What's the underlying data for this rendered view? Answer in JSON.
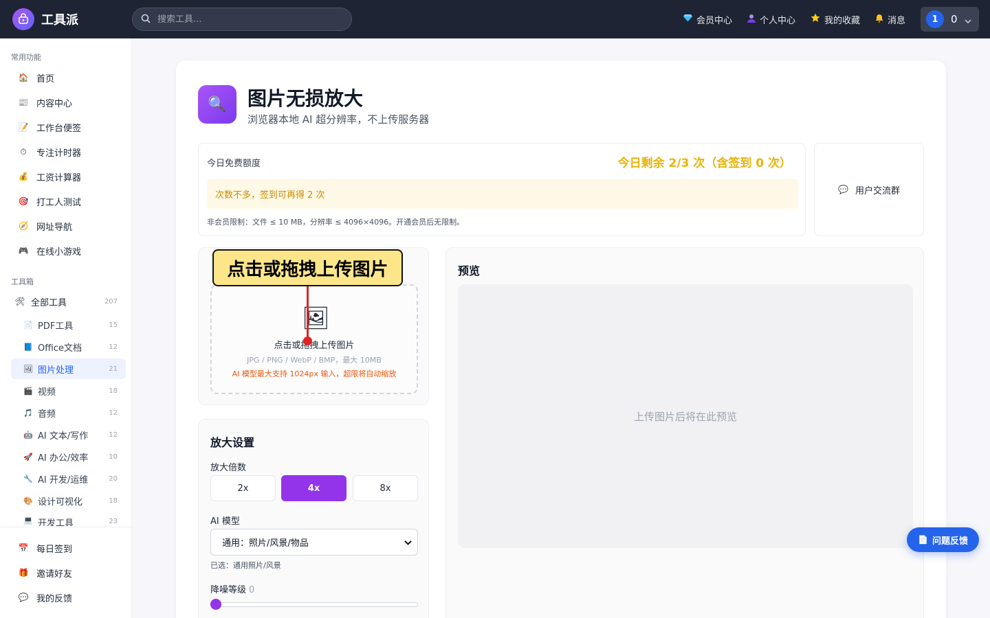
{
  "header": {
    "app_name": "工具派",
    "search_placeholder": "搜索工具...",
    "links": [
      {
        "icon": "gem-icon",
        "label": "会员中心"
      },
      {
        "icon": "person-icon",
        "label": "个人中心"
      },
      {
        "icon": "star-icon",
        "label": "我的收藏"
      },
      {
        "icon": "bell-icon",
        "label": "消息"
      }
    ],
    "user": {
      "avatar": "1",
      "count": "0"
    }
  },
  "sidebar": {
    "common_title": "常用功能",
    "common": [
      {
        "icon": "🏠",
        "label": "首页"
      },
      {
        "icon": "📰",
        "label": "内容中心"
      },
      {
        "icon": "📝",
        "label": "工作台便签"
      },
      {
        "icon": "⏱",
        "label": "专注计时器"
      },
      {
        "icon": "💰",
        "label": "工资计算器"
      },
      {
        "icon": "🎯",
        "label": "打工人测试"
      },
      {
        "icon": "🧭",
        "label": "网址导航"
      },
      {
        "icon": "🎮",
        "label": "在线小游戏"
      }
    ],
    "toolbox_title": "工具箱",
    "all_tools": {
      "icon": "🛠",
      "label": "全部工具",
      "count": "207"
    },
    "categories": [
      {
        "icon": "📄",
        "label": "PDF工具",
        "count": "15"
      },
      {
        "icon": "📘",
        "label": "Office文档",
        "count": "12"
      },
      {
        "icon": "🖼",
        "label": "图片处理",
        "count": "21"
      },
      {
        "icon": "🎬",
        "label": "视频",
        "count": "18"
      },
      {
        "icon": "🎵",
        "label": "音频",
        "count": "12"
      },
      {
        "icon": "🤖",
        "label": "AI 文本/写作",
        "count": "12"
      },
      {
        "icon": "🚀",
        "label": "AI 办公/效率",
        "count": "10"
      },
      {
        "icon": "🔧",
        "label": "AI 开发/运维",
        "count": "20"
      },
      {
        "icon": "🎨",
        "label": "设计可视化",
        "count": "18"
      },
      {
        "icon": "💻",
        "label": "开发工具",
        "count": "23"
      }
    ],
    "bottom": [
      {
        "icon": "📅",
        "label": "每日签到"
      },
      {
        "icon": "🎁",
        "label": "邀请好友"
      },
      {
        "icon": "💬",
        "label": "我的反馈"
      }
    ]
  },
  "page": {
    "title_icon": "🔍",
    "title": "图片无损放大",
    "subtitle": "浏览器本地 AI 超分辨率，不上传服务器"
  },
  "quota": {
    "label": "今日免费额度",
    "remaining": "今日剩余 2/3 次（含签到 0 次）",
    "warning": "次数不多，签到可再得 2 次",
    "note": "非会员限制：文件 ≤ 10 MB，分辨率 ≤ 4096×4096。开通会员后无限制。"
  },
  "group": {
    "icon": "💬",
    "label": "用户交流群"
  },
  "upload": {
    "callout": "点击或拖拽上传图片",
    "icon": "🖼",
    "main": "点击或拖拽上传图片",
    "formats": "JPG / PNG / WebP / BMP，最大 10MB",
    "hint": "AI 模型最大支持 1024px 输入，超限将自动缩放"
  },
  "settings": {
    "title": "放大设置",
    "scale_label": "放大倍数",
    "scales": [
      "2x",
      "4x",
      "8x"
    ],
    "selected_scale": "4x",
    "model_label": "AI 模型",
    "model_value": "通用：照片/风景/物品",
    "model_picked": "已选：通用照片/风景",
    "noise_label": "降噪等级",
    "noise_value": "0"
  },
  "preview": {
    "title": "预览",
    "placeholder": "上传图片后将在此预览"
  },
  "feedback": {
    "icon": "📄",
    "label": "问题反馈"
  },
  "colors": {
    "accent": "#9333ea",
    "primary": "#2563eb",
    "topbar": "#1e2433",
    "warn": "#eab308"
  }
}
